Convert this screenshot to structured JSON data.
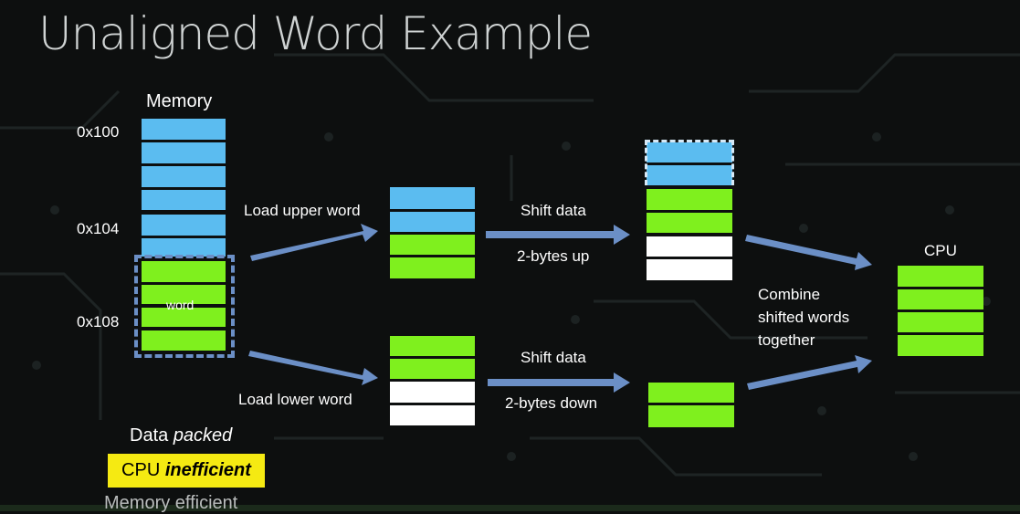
{
  "slide": {
    "title": "Unaligned Word Example"
  },
  "memory": {
    "heading": "Memory",
    "addresses": [
      "0x100",
      "0x104",
      "0x108"
    ],
    "word_label": "word"
  },
  "steps": {
    "load_upper": "Load upper word",
    "load_lower": "Load lower word",
    "shift_up_1": "Shift data",
    "shift_up_2": "2-bytes up",
    "shift_down_1": "Shift data",
    "shift_down_2": "2-bytes down",
    "combine_1": "Combine",
    "combine_2": "shifted words",
    "combine_3": "together",
    "cpu": "CPU"
  },
  "footer": {
    "packed_prefix": "Data ",
    "packed_em": "packed",
    "cpu_prefix": "CPU ",
    "cpu_em": "inefficient",
    "memory_efficient": "Memory efficient"
  },
  "colors": {
    "blue": "#5bbcf0",
    "green": "#7ff01e",
    "white": "#ffffff",
    "arrow": "#6b8fc6",
    "highlight": "#f5ea12"
  }
}
